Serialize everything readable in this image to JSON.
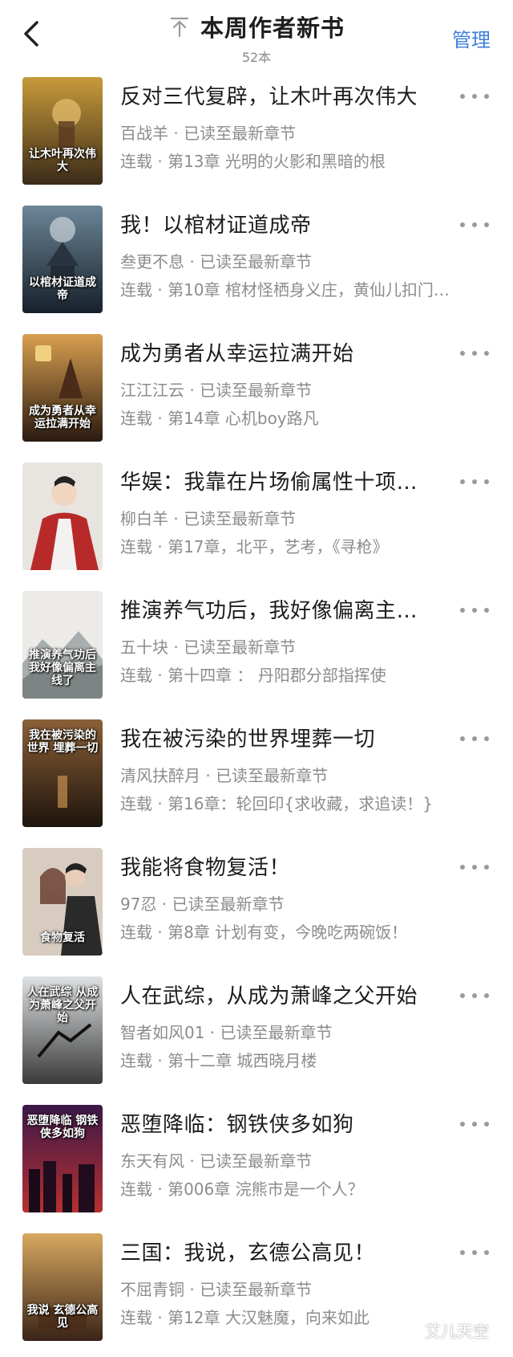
{
  "header": {
    "title": "本周作者新书",
    "count": "52本",
    "manage": "管理"
  },
  "books": [
    {
      "title": "反对三代复辟，让木叶再次伟大",
      "author_line": "百战羊 · 已读至最新章节",
      "chapter_line": "连载 · 第13章 光明的火影和黑暗的根",
      "cover_text": "让木叶再次伟大",
      "cover_colors": [
        "#c89a3a",
        "#3a2a18"
      ]
    },
    {
      "title": "我！以棺材证道成帝",
      "author_line": "叁更不息 · 已读至最新章节",
      "chapter_line": "连载 · 第10章 棺材怪栖身义庄，黄仙儿扣门…",
      "cover_text": "以棺材证道成帝",
      "cover_colors": [
        "#3c5668",
        "#16202a"
      ]
    },
    {
      "title": "成为勇者从幸运拉满开始",
      "author_line": "江江江云 · 已读至最新章节",
      "chapter_line": "连载 · 第14章 心机boy路凡",
      "cover_text": "成为勇者从幸运拉满开始",
      "cover_colors": [
        "#b07a2a",
        "#2a1a10"
      ]
    },
    {
      "title": "华娱：我靠在片场偷属性十项…",
      "author_line": "柳白羊 · 已读至最新章节",
      "chapter_line": "连载 · 第17章，北平，艺考，《寻枪》",
      "cover_text": "",
      "cover_colors": [
        "#e8e4e0",
        "#b82a2a"
      ]
    },
    {
      "title": "推演养气功后，我好像偏离主…",
      "author_line": "五十块 · 已读至最新章节",
      "chapter_line": "连载 · 第十四章 ： 丹阳郡分部指挥使",
      "cover_text": "推演养气功后 我好像偏离主线了",
      "cover_colors": [
        "#e6e6e2",
        "#9aa0a0"
      ]
    },
    {
      "title": "我在被污染的世界埋葬一切",
      "author_line": "清风扶醉月 · 已读至最新章节",
      "chapter_line": "连载 · 第16章：轮回印{求收藏，求追读！}",
      "cover_text": "我在被污染的世界 埋葬一切",
      "cover_colors": [
        "#6a4a2a",
        "#2a1c10"
      ]
    },
    {
      "title": "我能将食物复活！",
      "author_line": "97忍 · 已读至最新章节",
      "chapter_line": "连载 · 第8章 计划有变，今晚吃两碗饭！",
      "cover_text": "食物复活",
      "cover_colors": [
        "#d8c8b8",
        "#6a4a3a"
      ]
    },
    {
      "title": "人在武综，从成为萧峰之父开始",
      "author_line": "智者如风01 · 已读至最新章节",
      "chapter_line": "连载 · 第十二章 城西晓月楼",
      "cover_text": "人在武综 从成为萧峰之父开始",
      "cover_colors": [
        "#cfd2d4",
        "#3a3a3a"
      ]
    },
    {
      "title": "恶堕降临：钢铁侠多如狗",
      "author_line": "东天有风 · 已读至最新章节",
      "chapter_line": "连载 · 第006章 浣熊市是一个人？",
      "cover_text": "恶堕降临 钢铁侠多如狗",
      "cover_colors": [
        "#3a1848",
        "#b83030"
      ]
    },
    {
      "title": "三国：我说，玄德公高见！",
      "author_line": "不屈青铜 · 已读至最新章节",
      "chapter_line": "连载 · 第12章 大汉魅魔，向来如此",
      "cover_text": "我说 玄德公高见",
      "cover_colors": [
        "#c89048",
        "#3a2418"
      ]
    }
  ],
  "watermark": "艾儿天空"
}
